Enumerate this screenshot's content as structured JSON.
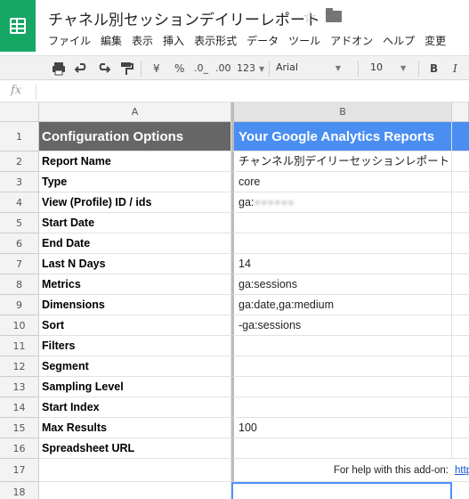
{
  "header": {
    "title": "チャネル別セッションデイリーレポート",
    "menu": [
      "ファイル",
      "編集",
      "表示",
      "挿入",
      "表示形式",
      "データ",
      "ツール",
      "アドオン",
      "ヘルプ",
      "変更"
    ]
  },
  "toolbar": {
    "currency": "¥",
    "percent": "%",
    "dec_decrease": ".0_",
    "dec_increase": ".00",
    "number_format": "123",
    "font": "Arial",
    "font_size": "10",
    "bold": "B",
    "italic": "I"
  },
  "formula_bar": {
    "fx": "fx",
    "value": ""
  },
  "grid": {
    "columns": [
      "A",
      "B"
    ],
    "rows": [
      {
        "num": "1",
        "a": "Configuration Options",
        "b": "Your Google Analytics Reports"
      },
      {
        "num": "2",
        "a": "Report Name",
        "b": "チャンネル別デイリーセッションレポート"
      },
      {
        "num": "3",
        "a": "Type",
        "b": "core"
      },
      {
        "num": "4",
        "a": "View (Profile) ID / ids",
        "b": "ga:"
      },
      {
        "num": "5",
        "a": "Start Date",
        "b": ""
      },
      {
        "num": "6",
        "a": "End Date",
        "b": ""
      },
      {
        "num": "7",
        "a": "Last N Days",
        "b": "14"
      },
      {
        "num": "8",
        "a": "Metrics",
        "b": "ga:sessions"
      },
      {
        "num": "9",
        "a": "Dimensions",
        "b": "ga:date,ga:medium"
      },
      {
        "num": "10",
        "a": "Sort",
        "b": "-ga:sessions"
      },
      {
        "num": "11",
        "a": "Filters",
        "b": ""
      },
      {
        "num": "12",
        "a": "Segment",
        "b": ""
      },
      {
        "num": "13",
        "a": "Sampling Level",
        "b": ""
      },
      {
        "num": "14",
        "a": "Start Index",
        "b": ""
      },
      {
        "num": "15",
        "a": "Max Results",
        "b": "100"
      },
      {
        "num": "16",
        "a": "Spreadsheet URL",
        "b": ""
      },
      {
        "num": "17",
        "a": "",
        "b": "For help with this add-on:",
        "c": "http"
      },
      {
        "num": "18",
        "a": "",
        "b": ""
      }
    ]
  },
  "colors": {
    "logo_green": "#16a765",
    "header_gray": "#666666",
    "header_blue": "#4a8ef2",
    "selection_blue": "#4d90fe",
    "link_blue": "#1155cc"
  }
}
